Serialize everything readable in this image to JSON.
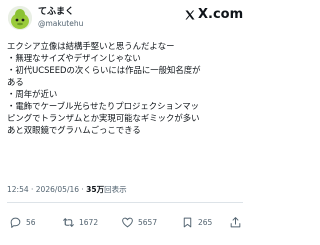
{
  "author": {
    "display_name": "てふまく",
    "handle": "@makutehu",
    "avatar_icon": "green-character-avatar"
  },
  "platform": {
    "logo_text": "X.com",
    "logo_icon": "x-logo-icon"
  },
  "post": {
    "lines": [
      "エクシア立像は結構手堅いと思うんだよなー",
      "・無理なサイズやデザインじゃない",
      "・初代UCSEEDの次くらいには作品に一般知名度が",
      "ある",
      "・周年が近い",
      "・電飾でケーブル光らせたりプロジェクションマッ",
      "ピングでトランザムとか実現可能なギミックが多い",
      "あと双眼鏡でグラハムごっこできる"
    ]
  },
  "meta": {
    "time": "12:54",
    "separator1": " · ",
    "date": "2026/05/16",
    "separator2": " · ",
    "views": "35万",
    "views_suffix": "回表示"
  },
  "actions": {
    "reply_count": "56",
    "repost_count": "1672",
    "like_count": "5657",
    "bookmark_count": "265"
  },
  "colors": {
    "text": "#0f1419",
    "secondary": "#536471",
    "divider": "#dde3e8"
  }
}
